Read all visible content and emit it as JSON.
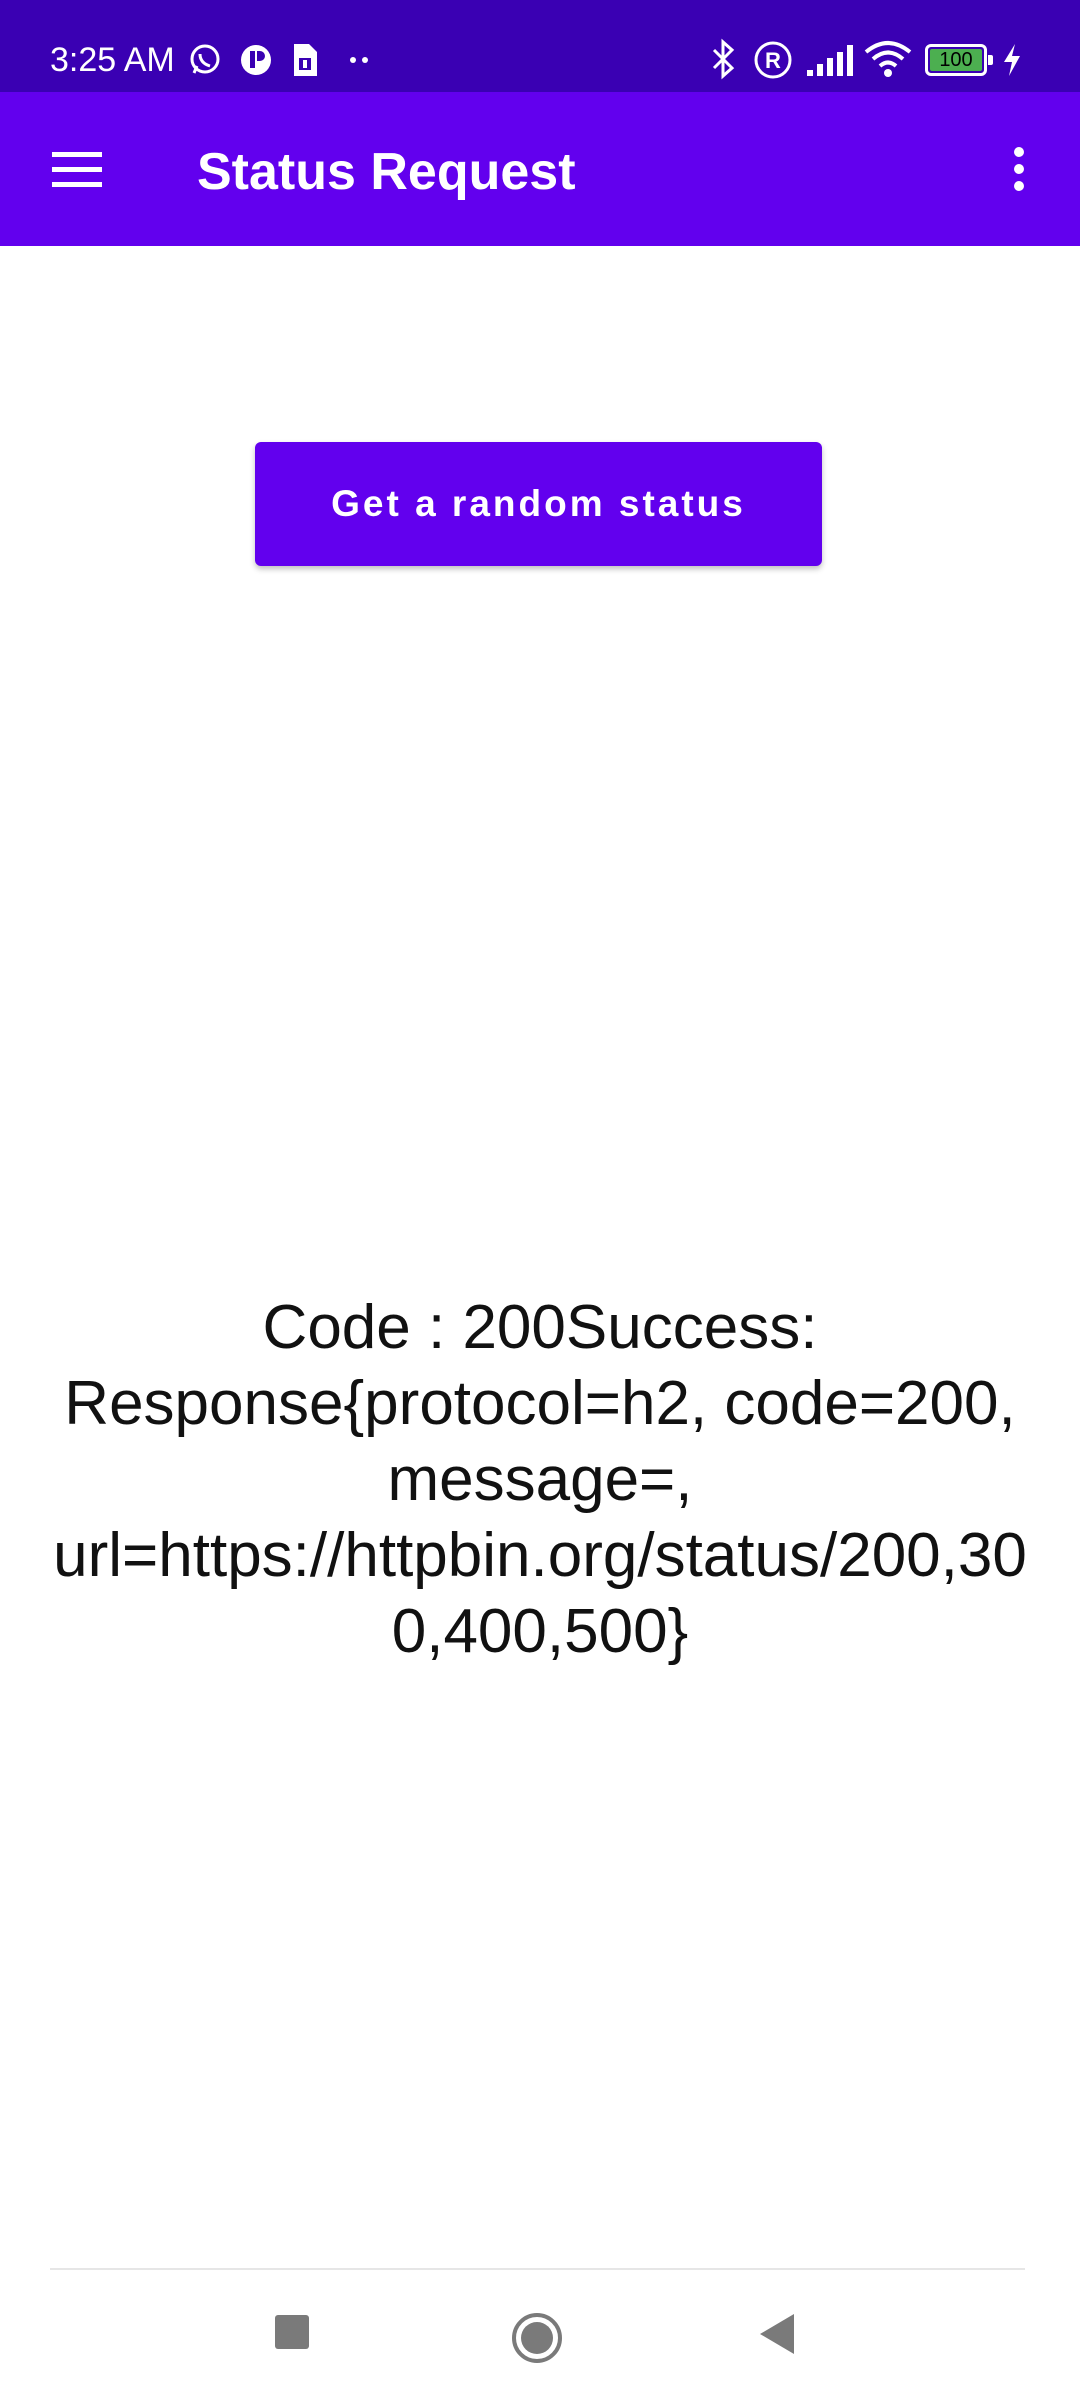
{
  "status_bar": {
    "time": "3:25 AM",
    "battery_level": "100",
    "icons": [
      "whatsapp-icon",
      "app-notification-icon",
      "sim-icon",
      "more-dots-icon",
      "bluetooth-icon",
      "roaming-icon",
      "signal-icon",
      "wifi-icon",
      "battery-icon",
      "charging-icon"
    ]
  },
  "app_bar": {
    "title": "Status Request",
    "menu_icon": "hamburger-menu-icon",
    "overflow_icon": "more-vert-icon"
  },
  "main": {
    "button_label": "Get a random status",
    "result": "Code : 200Success: Response{protocol=h2, code=200, message=, url=https://httpbin.org/status/200,300,400,500}"
  },
  "nav_bar": {
    "buttons": [
      "recents-icon",
      "home-icon",
      "back-icon"
    ]
  },
  "colors": {
    "status_bar": "#3a00b3",
    "primary": "#6200ee",
    "on_primary": "#ffffff",
    "text": "#111111"
  }
}
